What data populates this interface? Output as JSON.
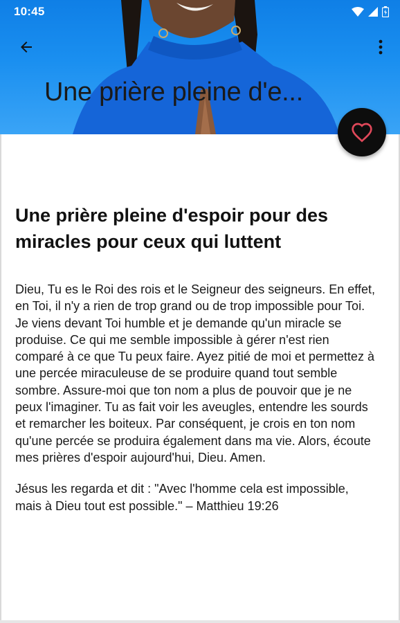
{
  "status_bar": {
    "time": "10:45",
    "icons": [
      "wifi-icon",
      "signal-icon",
      "battery-icon"
    ]
  },
  "toolbar": {
    "back_icon": "arrow-back-icon",
    "menu_icon": "more-vert-icon",
    "collapsed_title": "Une prière pleine d'e..."
  },
  "fab": {
    "icon": "heart-outline-icon",
    "icon_color": "#e0485a"
  },
  "colors": {
    "hero_blue": "#1a8ff0",
    "fab_background": "#0d0d0d"
  },
  "article": {
    "title": "Une prière pleine d'espoir pour des miracles pour ceux qui luttent",
    "paragraphs": [
      "Dieu, Tu es le Roi des rois et le Seigneur des seigneurs. En effet, en Toi, il n'y a rien de trop grand ou de trop impossible pour Toi. Je viens devant Toi humble et je demande qu'un miracle se produise. Ce qui me semble impossible à gérer n'est rien comparé à ce que Tu peux faire. Ayez pitié de moi et permettez à une percée miraculeuse de se produire quand tout semble sombre. Assure-moi que ton nom a plus de pouvoir que je ne peux l'imaginer. Tu as fait voir les aveugles, entendre les sourds et remarcher les boiteux. Par conséquent, je crois en ton nom qu'une percée se produira également dans ma vie. Alors, écoute mes prières d'espoir aujourd'hui, Dieu. Amen.",
      "Jésus les regarda et dit : \"Avec l'homme cela est impossible, mais à Dieu tout est possible.\" – Matthieu 19:26"
    ]
  }
}
